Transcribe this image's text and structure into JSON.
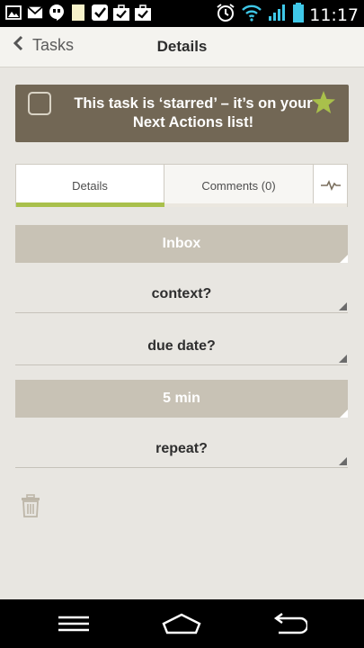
{
  "status_bar": {
    "time": "11:17",
    "icons": [
      "image-icon",
      "mail-icon",
      "hangouts-icon",
      "note-icon",
      "check-icon",
      "briefcase-check-icon",
      "briefcase-check-icon",
      "alarm-icon",
      "wifi-icon",
      "signal-icon",
      "battery-icon"
    ]
  },
  "header": {
    "back_label": "Tasks",
    "title": "Details"
  },
  "banner": {
    "text": "This task is ‘starred’ – it’s on your Next Actions list!",
    "star_color": "#a9c04b"
  },
  "tabs": [
    {
      "label": "Details",
      "active": true
    },
    {
      "label": "Comments (0)",
      "active": false
    },
    {
      "label": "",
      "icon": "activity-icon"
    }
  ],
  "fields": {
    "folder": "Inbox",
    "context": "context?",
    "due_date": "due date?",
    "duration": "5 min",
    "repeat": "repeat?"
  },
  "nav": {
    "icons": [
      "menu-icon",
      "home-icon",
      "back-icon"
    ]
  },
  "colors": {
    "accent": "#a9c04b",
    "banner_bg": "#726755",
    "filled_field": "#c8c2b5"
  }
}
